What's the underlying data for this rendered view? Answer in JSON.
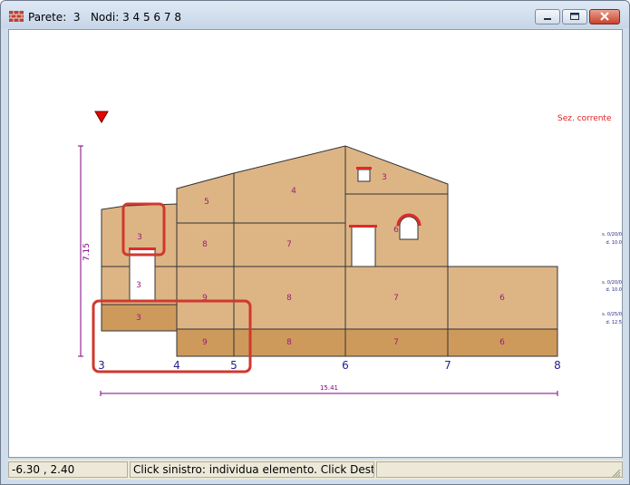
{
  "window": {
    "title": "Parete:  3   Nodi: 3 4 5 6 7 8"
  },
  "drawing": {
    "section_label": "Sez. corrente",
    "height_dim": "7.15",
    "width_dim": "15.41",
    "node_labels": [
      "3",
      "4",
      "5",
      "6",
      "7",
      "8"
    ],
    "panel_numbers": {
      "p3_top": "3",
      "p3_mid": "3",
      "p3_low": "3",
      "p5": "5",
      "p4": "4",
      "p3_attic": "3",
      "p8a": "8",
      "p7a": "7",
      "p6_upper": "6",
      "p9a": "9",
      "p8b": "8",
      "p7b": "7",
      "p6b": "6",
      "p9c": "9",
      "p8c": "8",
      "p7c": "7",
      "p6c": "6"
    },
    "side_notes": [
      {
        "a": "s. 0/20/0",
        "b": "d. 10.0"
      },
      {
        "a": "s. 0/20/0",
        "b": "d. 10.0"
      },
      {
        "a": "s. 0/25/0",
        "b": "d. 12.5"
      }
    ]
  },
  "status": {
    "coords": "-6.30 , 2.40",
    "hint": "Click sinistro: individua elemento. Click Destro: spo",
    "extra": ""
  },
  "colors": {
    "wall_fill": "#ddb585",
    "base_fill": "#cd9a5c",
    "label_color": "#9b1c71",
    "node_color": "#1f1f8e",
    "dimension_color": "#800080",
    "highlight": "#d0382f"
  }
}
